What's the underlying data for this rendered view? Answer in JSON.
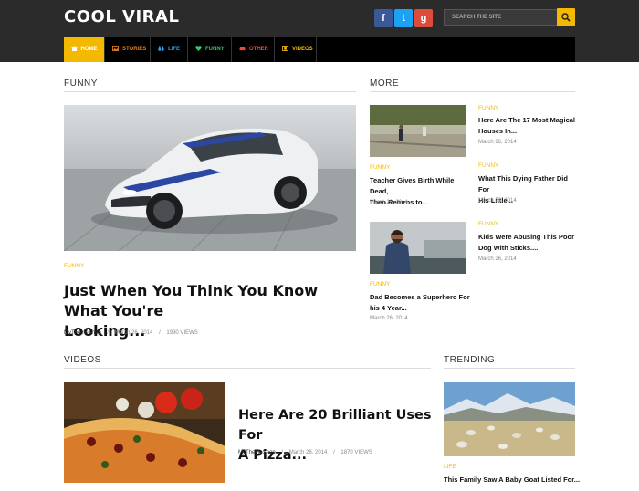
{
  "site": {
    "logo": "COOL VIRAL"
  },
  "header": {
    "social": [
      {
        "label": "f",
        "name": "facebook",
        "color": "#3b5998"
      },
      {
        "label": "t",
        "name": "twitter",
        "color": "#1da1f2"
      },
      {
        "label": "g",
        "name": "google-plus",
        "color": "#dd4b39"
      }
    ],
    "search_placeholder": "SEARCH THE SITE"
  },
  "nav": {
    "items": [
      {
        "label": "HOME",
        "color": "#ffffff"
      },
      {
        "label": "STORIES",
        "color": "#e67e22"
      },
      {
        "label": "LIFE",
        "color": "#3498db"
      },
      {
        "label": "FUNNY",
        "color": "#2ecc71"
      },
      {
        "label": "OTHER",
        "color": "#e74c3c"
      },
      {
        "label": "VIDEOS",
        "color": "#f5b800"
      }
    ]
  },
  "sections": {
    "funny": "FUNNY",
    "more": "MORE",
    "videos": "VIDEOS",
    "trending": "TRENDING"
  },
  "featured": {
    "category": "FUNNY",
    "title_line1": "Just When You Think You Know What You're",
    "title_line2": "Looking...",
    "author": "MyThemeShop",
    "date": "March 26, 2014",
    "views": "1930 VIEWS"
  },
  "more": [
    {
      "category": "FUNNY",
      "title_line1": "Here Are The 17 Most Magical",
      "title_line2": "Houses In...",
      "date": "March 26, 2014"
    },
    {
      "category": "FUNNY",
      "title_line1": "Teacher Gives Birth While Dead,",
      "title_line2": "Then Returns to...",
      "date": "March 26, 2014"
    },
    {
      "category": "FUNNY",
      "title_line1": "What This Dying Father Did For",
      "title_line2": "His Little...",
      "date": "March 26, 2014"
    },
    {
      "category": "FUNNY",
      "title_line1": "Kids Were Abusing This Poor",
      "title_line2": "Dog With Sticks....",
      "date": "March 26, 2014"
    },
    {
      "category": "FUNNY",
      "title_line1": "Dad Becomes a Superhero For",
      "title_line2": "his 4 Year...",
      "date": "March 26, 2014"
    }
  ],
  "video": {
    "title_line1": "Here Are 20 Brilliant Uses For",
    "title_line2": "A Pizza...",
    "author": "MyThemeShop",
    "date": "March 26, 2014",
    "views": "1870 VIEWS"
  },
  "trending": {
    "category": "LIFE",
    "title": "This Family Saw A Baby Goat Listed For..."
  },
  "separator": "/"
}
